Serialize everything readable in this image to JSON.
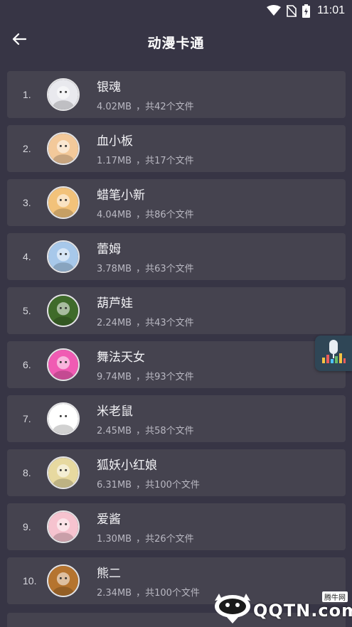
{
  "status_bar": {
    "time": "11:01",
    "icons": [
      "wifi-icon",
      "no-sim-icon",
      "battery-charging-icon"
    ]
  },
  "app_bar": {
    "title": "动漫卡通",
    "back_icon": "arrow-left-icon"
  },
  "list": {
    "items": [
      {
        "index": "1.",
        "title": "银魂",
        "size": "4.02MB",
        "count": "，共42个文件",
        "avatar_color": "#e9e9ee"
      },
      {
        "index": "2.",
        "title": "血小板",
        "size": "1.17MB",
        "count": "，共17个文件",
        "avatar_color": "#f3c99a"
      },
      {
        "index": "3.",
        "title": "蜡笔小新",
        "size": "4.04MB",
        "count": "，共86个文件",
        "avatar_color": "#f2c27a"
      },
      {
        "index": "4.",
        "title": "蕾姆",
        "size": "3.78MB",
        "count": "，共63个文件",
        "avatar_color": "#a7c8ea"
      },
      {
        "index": "5.",
        "title": "葫芦娃",
        "size": "2.24MB",
        "count": "，共43个文件",
        "avatar_color": "#3f6b2a"
      },
      {
        "index": "6.",
        "title": "舞法天女",
        "size": "9.74MB",
        "count": "，共93个文件",
        "avatar_color": "#f05bb3"
      },
      {
        "index": "7.",
        "title": "米老鼠",
        "size": "2.45MB",
        "count": "，共58个文件",
        "avatar_color": "#ffffff"
      },
      {
        "index": "8.",
        "title": "狐妖小红娘",
        "size": "6.31MB",
        "count": "，共100个文件",
        "avatar_color": "#e7d9a0"
      },
      {
        "index": "9.",
        "title": "爱酱",
        "size": "1.30MB",
        "count": "，共26个文件",
        "avatar_color": "#f6c3cf"
      },
      {
        "index": "10.",
        "title": "熊二",
        "size": "2.34MB",
        "count": "，共100个文件",
        "avatar_color": "#b5742f"
      }
    ]
  },
  "floating_button": {
    "icon": "microphone-equalizer-icon"
  },
  "watermark": {
    "text": "QQTN.com",
    "small": "腾牛网"
  }
}
